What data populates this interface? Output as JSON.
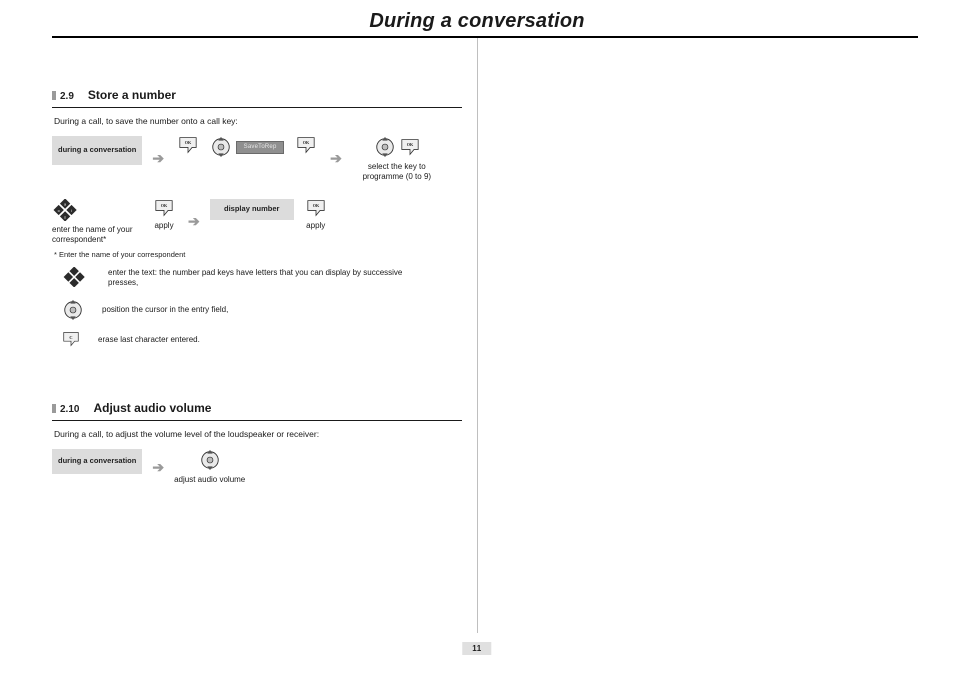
{
  "header": {
    "title": "During a conversation"
  },
  "page_number": "11",
  "sections": {
    "store": {
      "num": "2.9",
      "title": "Store a number",
      "intro": "During a call, to save the number onto a call key:",
      "flow1": {
        "box1": "during a conversation",
        "field_placeholder": "SaveToRep",
        "caption_select": "select the key to programme (0 to 9)"
      },
      "flow2": {
        "caption_enter": "enter the name of your correspondent*",
        "apply1": "apply",
        "box2": "display number",
        "apply2": "apply"
      },
      "footnote": "* Enter the name of your correspondent",
      "notes": {
        "n1": "enter the text: the number pad keys have letters that you can display by successive presses,",
        "n2": "position the cursor in the entry field,",
        "n3": "erase last character entered."
      }
    },
    "volume": {
      "num": "2.10",
      "title": "Adjust audio volume",
      "intro": "During a call, to adjust the volume level of the loudspeaker or receiver:",
      "box": "during a conversation",
      "caption": "adjust audio volume"
    }
  },
  "glyphs": {
    "arrow": "➔"
  }
}
